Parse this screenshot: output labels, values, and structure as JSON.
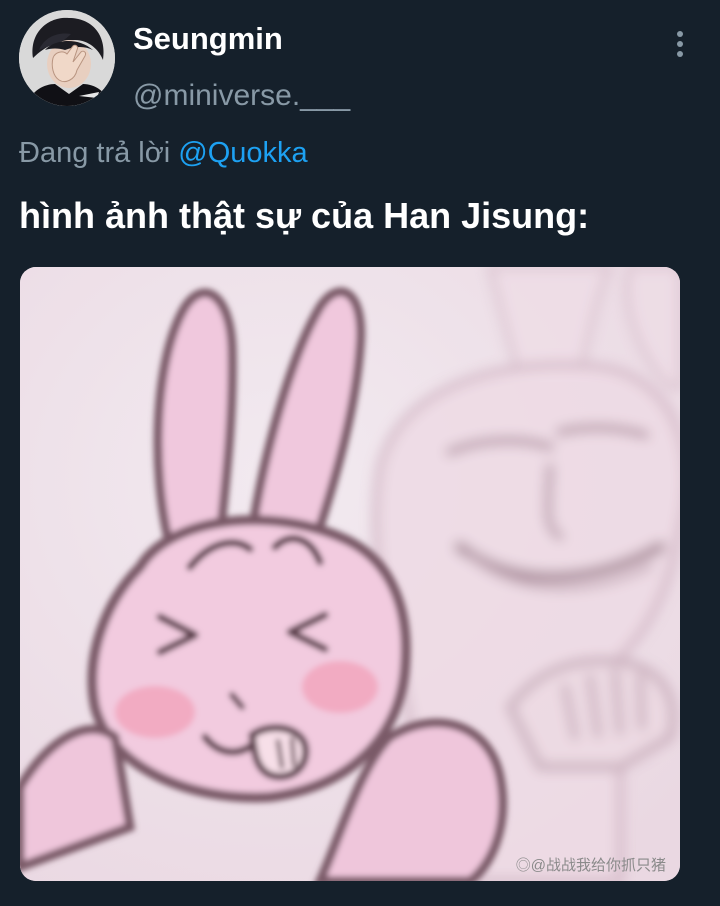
{
  "author": {
    "display_name": "Seungmin",
    "handle": "@miniverse.___",
    "avatar_icon": "person-covering-face-avatar"
  },
  "menu": {
    "icon": "more-vertical-icon"
  },
  "reply": {
    "prefix": "Đang trả lời ",
    "mention": "@Quokka"
  },
  "tweet": {
    "text": "hình ảnh thật sự của Han Jisung:"
  },
  "media": {
    "description_icon": "bunny-meme-image",
    "watermark": "◎@战战我给你抓只猪"
  },
  "colors": {
    "background": "#15202b",
    "primary_text": "#ffffff",
    "secondary_text": "#8899a6",
    "link": "#1da1f2"
  }
}
